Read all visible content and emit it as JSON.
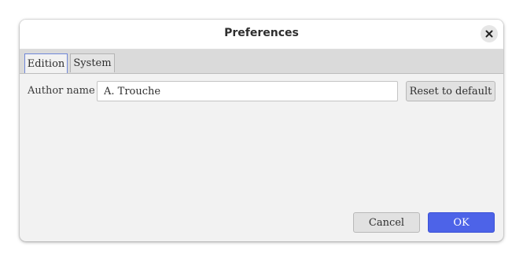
{
  "window": {
    "title": "Preferences",
    "close_icon": "close-icon"
  },
  "tabs": [
    {
      "label": "Edition",
      "active": true
    },
    {
      "label": "System",
      "active": false
    }
  ],
  "edition": {
    "author_label": "Author name",
    "author_value": "A. Trouche",
    "reset_label": "Reset to default"
  },
  "footer": {
    "cancel_label": "Cancel",
    "ok_label": "OK"
  },
  "colors": {
    "accent": "#4d63e8",
    "active_tab_border": "#6f86d8"
  }
}
